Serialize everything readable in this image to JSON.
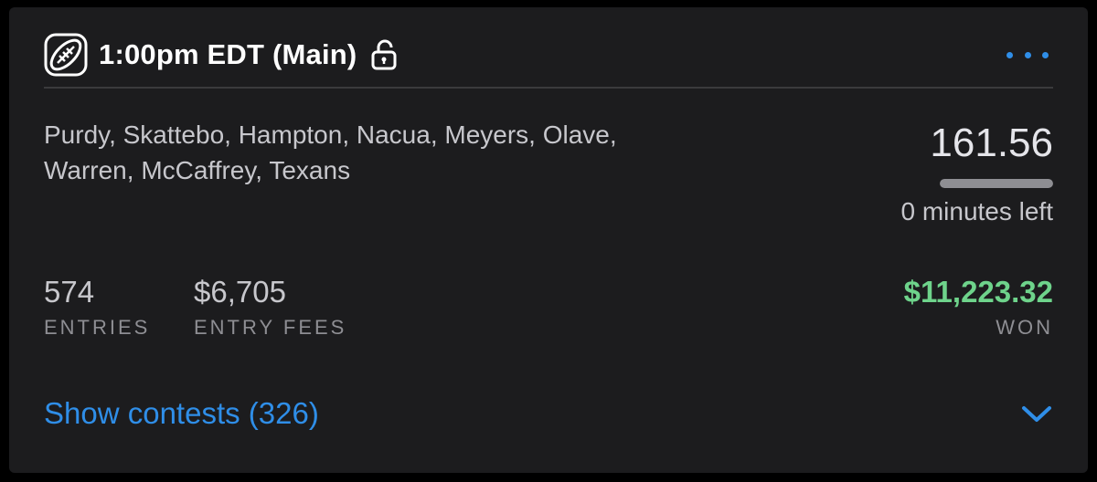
{
  "header": {
    "icon": "football-icon",
    "slate_title": "1:00pm EDT (Main)",
    "lock_icon": "unlock-icon",
    "more_icon": "more-dots-icon"
  },
  "lineup": {
    "players_line1": "Purdy, Skattebo, Hampton, Nacua, Meyers, Olave,",
    "players_line2": "Warren, McCaffrey, Texans"
  },
  "score": {
    "points": "161.56",
    "progress_fraction": 1.0,
    "time_left": "0 minutes left"
  },
  "stats": {
    "entries_value": "574",
    "entries_label": "ENTRIES",
    "fees_value": "$6,705",
    "fees_label": "ENTRY FEES",
    "won_value": "$11,223.32",
    "won_label": "WON"
  },
  "footer": {
    "show_contests_label": "Show contests (326)",
    "expand_icon": "chevron-down-icon"
  },
  "colors": {
    "background": "#000000",
    "card": "#1c1c1e",
    "accent_blue": "#2f8ee8",
    "won_green": "#6ed38b",
    "text_primary": "#ffffff",
    "text_secondary": "#c7c7cc",
    "text_muted": "#8e8e93"
  }
}
